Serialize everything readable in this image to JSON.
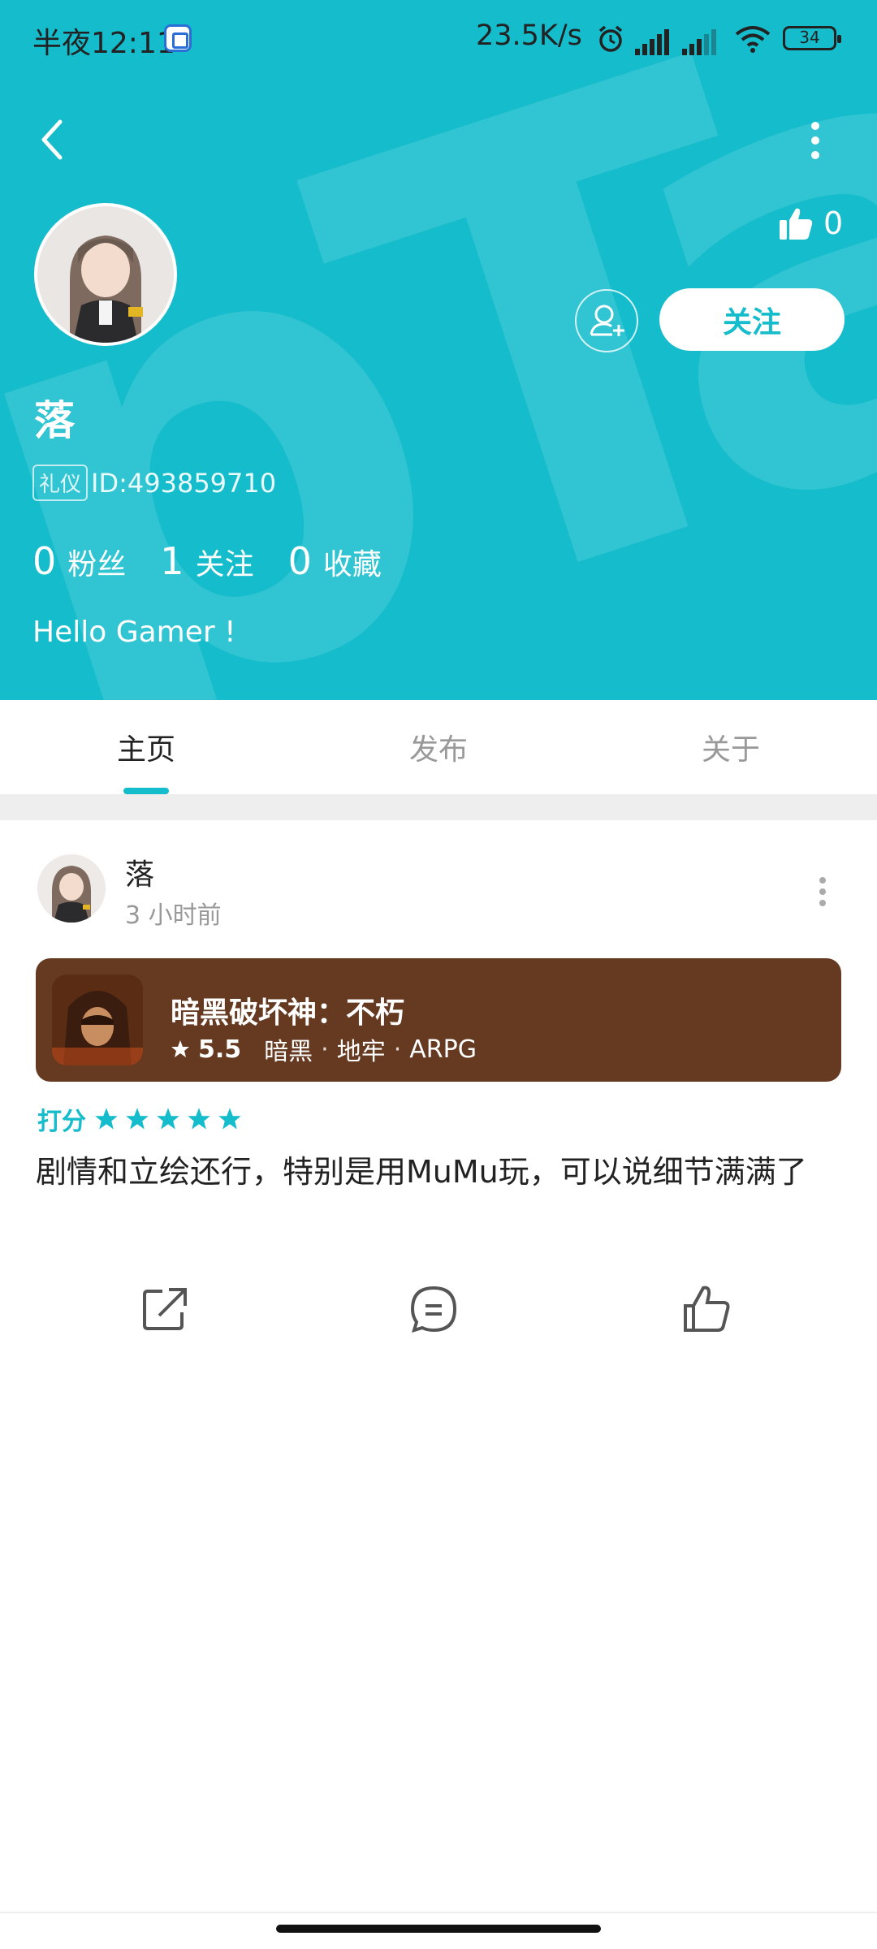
{
  "status_bar": {
    "time": "半夜12:11",
    "network_speed": "23.5K/s",
    "battery": "34",
    "icons": [
      "app-icon",
      "alarm-icon",
      "signal-hd-icon",
      "signal-hd-icon",
      "wifi-icon",
      "battery-icon"
    ]
  },
  "header": {
    "likes_count": "0",
    "follow_label": "关注",
    "accent_color": "#15bccc"
  },
  "profile": {
    "name": "落",
    "tag": "礼仪",
    "id_text": "ID:493859710",
    "stats": [
      {
        "num": "0",
        "label": "粉丝"
      },
      {
        "num": "1",
        "label": "关注"
      },
      {
        "num": "0",
        "label": "收藏"
      }
    ],
    "bio": "Hello Gamer !"
  },
  "tabs": [
    {
      "label": "主页",
      "active": true
    },
    {
      "label": "发布",
      "active": false
    },
    {
      "label": "关于",
      "active": false
    }
  ],
  "post": {
    "author": "落",
    "time": "3 小时前",
    "game": {
      "title": "暗黑破坏神：不朽",
      "score": "5.5",
      "tags": [
        "暗黑",
        "地牢",
        "ARPG"
      ],
      "card_color": "#663a21"
    },
    "rating_label": "打分",
    "stars": 5,
    "content": "剧情和立绘还行，特别是用MuMu玩，可以说细节满满了",
    "actions": [
      "share-icon",
      "comment-icon",
      "like-icon"
    ]
  }
}
